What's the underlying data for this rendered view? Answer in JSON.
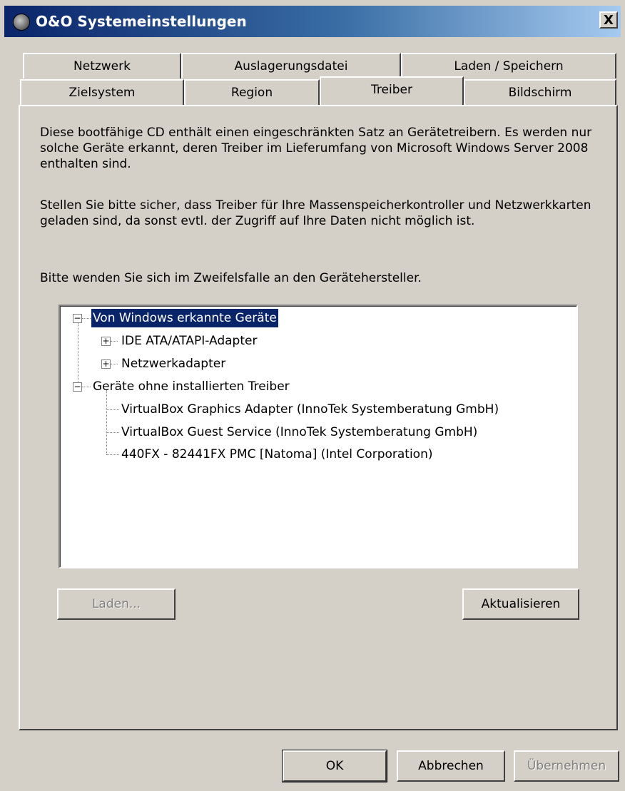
{
  "window": {
    "title": "O&O Systemeinstellungen",
    "close_label": "X"
  },
  "tabs": {
    "row_back": [
      "Netzwerk",
      "Auslagerungsdatei",
      "Laden / Speichern"
    ],
    "row_front": [
      "Zielsystem",
      "Region",
      "Treiber",
      "Bildschirm"
    ],
    "active": "Treiber"
  },
  "content": {
    "para1": "Diese bootfähige CD enthält einen eingeschränkten Satz an Gerätetreibern. Es werden nur solche Geräte erkannt, deren Treiber im Lieferumfang von Microsoft Windows Server 2008 enthalten sind.",
    "para2": "Stellen Sie bitte sicher, dass Treiber für Ihre Massenspeicherkontroller und Netzwerkkarten geladen sind, da sonst evtl. der Zugriff auf Ihre Daten nicht möglich ist.",
    "para3": "Bitte wenden Sie sich im Zweifelsfalle an den Gerätehersteller."
  },
  "tree": {
    "group1": {
      "label": "Von Windows erkannte Geräte",
      "children": [
        "IDE ATA/ATAPI-Adapter",
        "Netzwerkadapter"
      ]
    },
    "group2": {
      "label": "Geräte ohne installierten Treiber",
      "children": [
        "VirtualBox Graphics Adapter (InnoTek Systemberatung GmbH)",
        "VirtualBox Guest Service (InnoTek Systemberatung GmbH)",
        "440FX - 82441FX PMC [Natoma] (Intel Corporation)"
      ]
    }
  },
  "buttons": {
    "load": "Laden...",
    "refresh": "Aktualisieren",
    "ok": "OK",
    "cancel": "Abbrechen",
    "apply": "Übernehmen"
  },
  "colors": {
    "dialog_bg": "#d4d0c8",
    "selection": "#0a246a"
  }
}
